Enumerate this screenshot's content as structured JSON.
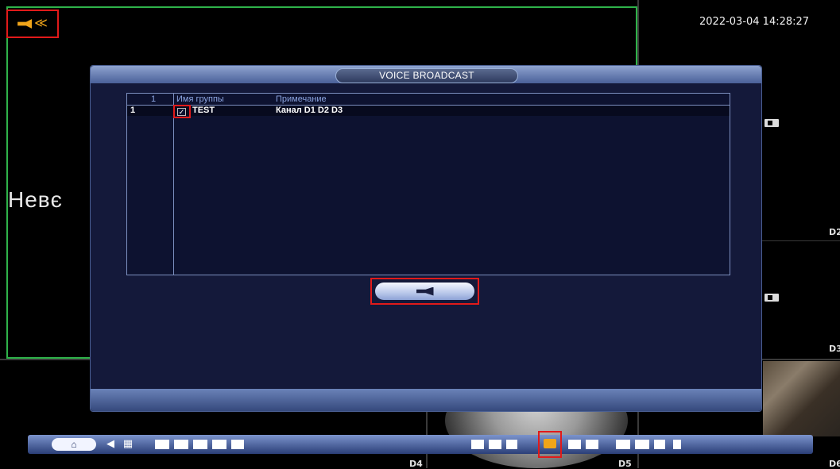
{
  "screen": {
    "timestamp": "2022-03-04 14:28:27",
    "channel_text": "Невє",
    "channel_labels": [
      "D2",
      "D3",
      "D4",
      "D5",
      "D6"
    ]
  },
  "dialog": {
    "title": "VOICE BROADCAST",
    "table": {
      "header_index": "1",
      "col_group": "Имя группы",
      "col_note": "Примечание",
      "rows": [
        {
          "index": "1",
          "checked": "✓",
          "group": "TEST",
          "note": "Канал D1 D2 D3"
        }
      ]
    }
  },
  "taskbar": {
    "home_icon": "⌂",
    "back_icon": "◀",
    "settings_icon": "▦"
  },
  "colors": {
    "highlight": "#e11a1a",
    "selected_channel": "#2fb34a",
    "audio_accent": "#f0a51a"
  }
}
